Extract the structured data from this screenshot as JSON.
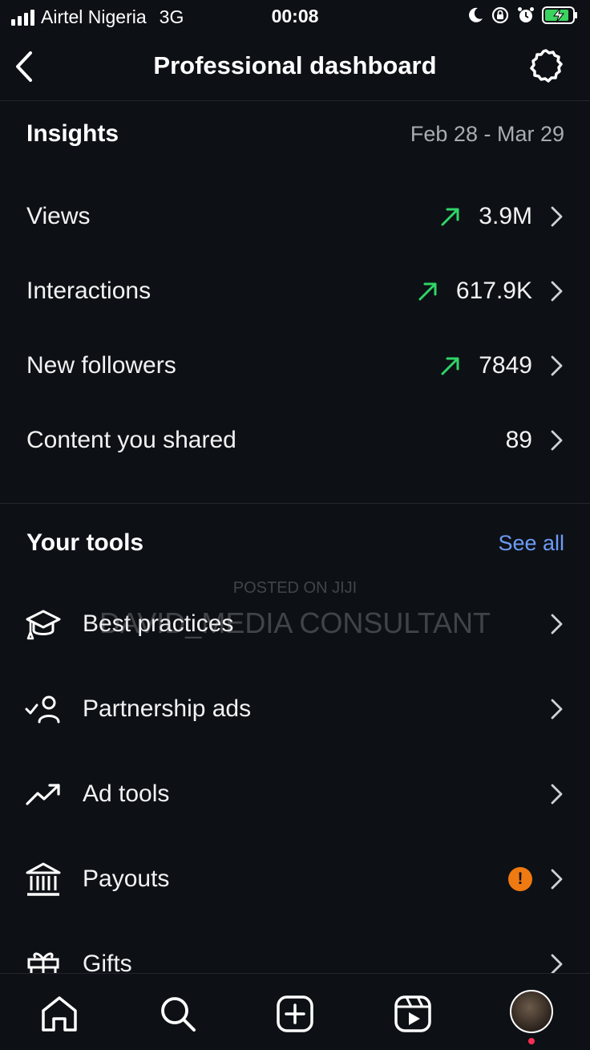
{
  "status_bar": {
    "carrier": "Airtel Nigeria",
    "network": "3G",
    "time": "00:08",
    "signal_bars": 4,
    "battery_charging": true
  },
  "nav": {
    "title": "Professional dashboard",
    "back_icon": "chevron-left-icon",
    "settings_icon": "gear-icon"
  },
  "insights": {
    "title": "Insights",
    "date_range": "Feb 28 - Mar 29",
    "rows": [
      {
        "label": "Views",
        "value": "3.9M",
        "trend": "up"
      },
      {
        "label": "Interactions",
        "value": "617.9K",
        "trend": "up"
      },
      {
        "label": "New followers",
        "value": "7849",
        "trend": "up"
      },
      {
        "label": "Content you shared",
        "value": "89",
        "trend": "none"
      }
    ]
  },
  "tools": {
    "title": "Your tools",
    "see_all": "See all",
    "items": [
      {
        "label": "Best practices",
        "icon": "graduation-cap-icon"
      },
      {
        "label": "Partnership ads",
        "icon": "partnership-icon"
      },
      {
        "label": "Ad tools",
        "icon": "trending-up-icon"
      },
      {
        "label": "Payouts",
        "icon": "bank-icon",
        "alert": "!"
      },
      {
        "label": "Gifts",
        "icon": "gift-icon"
      }
    ]
  },
  "watermark": {
    "line1": "POSTED ON JIJI",
    "line2": "DAVID_MEDIA CONSULTANT"
  },
  "tabbar": {
    "items": [
      "home-icon",
      "search-icon",
      "create-icon",
      "reels-icon",
      "profile-avatar"
    ]
  },
  "colors": {
    "background": "#0d1116",
    "trend_green": "#2fd567",
    "link_blue": "#6d9bf6",
    "alert_orange": "#f07a12"
  }
}
